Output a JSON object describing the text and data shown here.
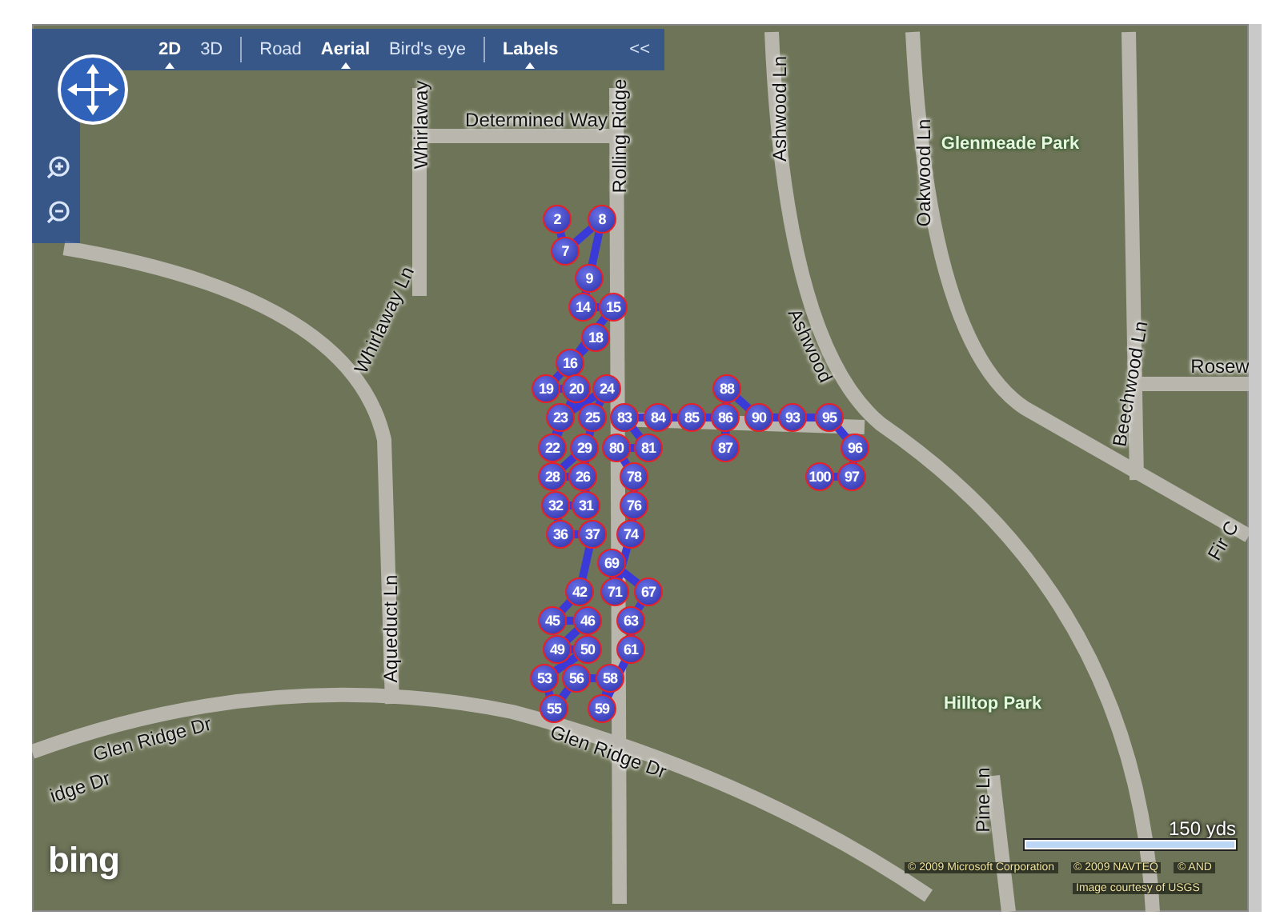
{
  "toolbar": {
    "view_modes": [
      {
        "label": "2D",
        "selected": true
      },
      {
        "label": "3D",
        "selected": false
      }
    ],
    "map_styles": [
      {
        "label": "Road",
        "selected": false
      },
      {
        "label": "Aerial",
        "selected": true
      },
      {
        "label": "Bird's eye",
        "selected": false
      }
    ],
    "labels_toggle": {
      "label": "Labels",
      "on": true
    },
    "collapse_button": "<<"
  },
  "map_labels": [
    {
      "text": "Determined Way",
      "kind": "road"
    },
    {
      "text": "Whirlaway",
      "kind": "road"
    },
    {
      "text": "Rolling Ridge",
      "kind": "road"
    },
    {
      "text": "Whirlaway Ln",
      "kind": "road"
    },
    {
      "text": "Ashwood Ln",
      "kind": "road"
    },
    {
      "text": "Oakwood Ln",
      "kind": "road"
    },
    {
      "text": "Glenmeade Park",
      "kind": "park"
    },
    {
      "text": "Rosew",
      "kind": "road"
    },
    {
      "text": "Beechwood Ln",
      "kind": "road"
    },
    {
      "text": "Ashwood",
      "kind": "road"
    },
    {
      "text": "Fir C",
      "kind": "road"
    },
    {
      "text": "Aqueduct Ln",
      "kind": "road"
    },
    {
      "text": "Hilltop Park",
      "kind": "park"
    },
    {
      "text": "Glen Ridge Dr",
      "kind": "road"
    },
    {
      "text": "Glen Ridge Dr",
      "kind": "road"
    },
    {
      "text": "idge Dr",
      "kind": "road"
    },
    {
      "text": "Pine Ln",
      "kind": "road"
    }
  ],
  "route_markers": [
    "2",
    "8",
    "7",
    "9",
    "14",
    "15",
    "18",
    "16",
    "19",
    "20",
    "24",
    "88",
    "23",
    "25",
    "83",
    "84",
    "85",
    "86",
    "90",
    "93",
    "95",
    "22",
    "29",
    "80",
    "81",
    "87",
    "96",
    "28",
    "26",
    "78",
    "100",
    "97",
    "32",
    "31",
    "76",
    "36",
    "37",
    "74",
    "69",
    "42",
    "71",
    "67",
    "45",
    "46",
    "63",
    "49",
    "50",
    "61",
    "53",
    "56",
    "58",
    "55",
    "59"
  ],
  "scale": {
    "label": "150 yds",
    "level": 0.9
  },
  "copyright": [
    "© 2009 Microsoft Corporation",
    "© 2009 NAVTEQ",
    "© AND"
  ],
  "image_credit": "Image courtesy of USGS",
  "logo": "bing"
}
